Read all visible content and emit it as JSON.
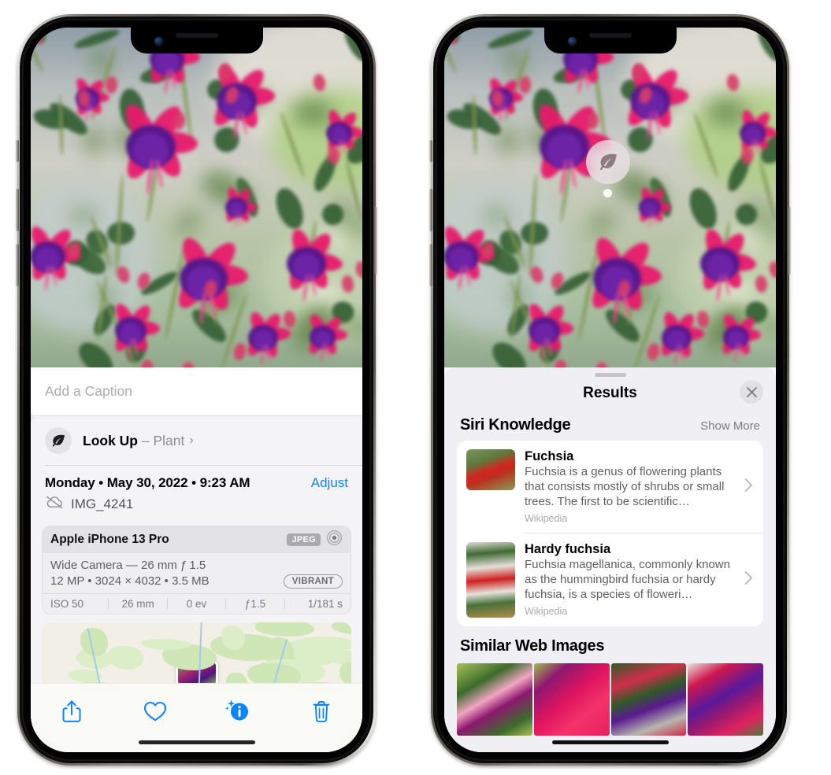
{
  "left_phone": {
    "name": "photos-detail-view",
    "caption": {
      "placeholder": "Add a Caption",
      "value": ""
    },
    "lookup": {
      "label": "Look Up",
      "dash": "–",
      "subject": "Plant",
      "icon": "leaf-icon",
      "chevron": "›"
    },
    "date": {
      "text": "Monday • May 30, 2022 • 9:23 AM",
      "adjust_label": "Adjust"
    },
    "file": {
      "name": "IMG_4241",
      "icon": "icloud-slash-icon"
    },
    "camera": {
      "device": "Apple iPhone 13 Pro",
      "format_badge": "JPEG",
      "aperture_icon": "aperture-icon",
      "lens_line": "Wide Camera — 26 mm ƒ 1.5",
      "specs_line": "12 MP • 3024 × 4032 • 3.5 MB",
      "style_badge": "VIBRANT",
      "exif": [
        "ISO 50",
        "26 mm",
        "0 ev",
        "ƒ1.5",
        "1/181 s"
      ]
    },
    "toolbar": [
      {
        "name": "share-button",
        "icon": "share-icon"
      },
      {
        "name": "favorite-button",
        "icon": "heart-icon"
      },
      {
        "name": "info-button",
        "icon": "info-sparkle-icon"
      },
      {
        "name": "delete-button",
        "icon": "trash-icon"
      }
    ],
    "accent_color": "#0b84ff"
  },
  "right_phone": {
    "name": "visual-lookup-results",
    "badge": {
      "name": "visual-lookup-leaf-badge",
      "icon": "leaf-icon"
    },
    "sheet": {
      "title": "Results",
      "close_icon": "close-icon",
      "sections": [
        {
          "title": "Siri Knowledge",
          "action": "Show More",
          "items": [
            {
              "title": "Fuchsia",
              "description": "Fuchsia is a genus of flowering plants that consists mostly of shrubs or small trees. The first to be scientific…",
              "source": "Wikipedia",
              "thumb": "fuchsia-thumb"
            },
            {
              "title": "Hardy fuchsia",
              "description": "Fuchsia magellanica, commonly known as the hummingbird fuchsia or hardy fuchsia, is a species of floweri…",
              "source": "Wikipedia",
              "thumb": "hardy-fuchsia-thumb"
            }
          ]
        },
        {
          "title": "Similar Web Images",
          "items": [
            {
              "thumb": "web-image-1"
            },
            {
              "thumb": "web-image-2"
            },
            {
              "thumb": "web-image-3"
            },
            {
              "thumb": "web-image-4"
            }
          ]
        }
      ]
    }
  },
  "colors": {
    "accent": "#0b84ff",
    "sheet_bg": "#f0f0f4",
    "card_bg": "#ffffff",
    "secondary_text": "#8e8e93"
  }
}
